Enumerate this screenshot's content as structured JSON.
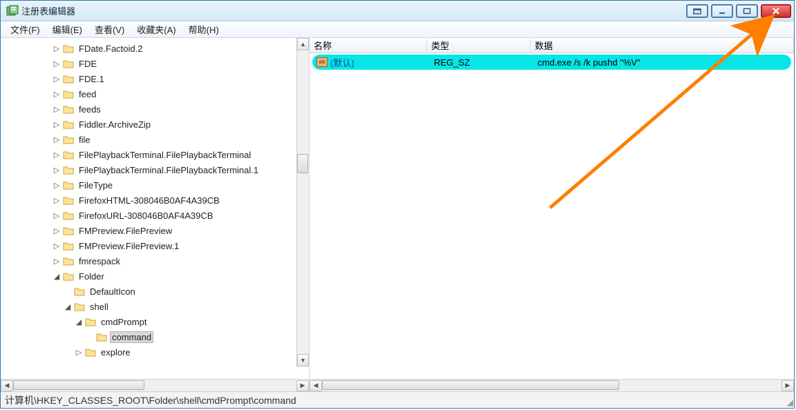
{
  "window": {
    "title": "注册表编辑器"
  },
  "menu": {
    "file": "文件(F)",
    "edit": "编辑(E)",
    "view": "查看(V)",
    "fav": "收藏夹(A)",
    "help": "帮助(H)"
  },
  "tree": {
    "nodes": [
      {
        "depth": 3,
        "expand": "▷",
        "label": "FDate.Factoid.2"
      },
      {
        "depth": 3,
        "expand": "▷",
        "label": "FDE"
      },
      {
        "depth": 3,
        "expand": "▷",
        "label": "FDE.1"
      },
      {
        "depth": 3,
        "expand": "▷",
        "label": "feed"
      },
      {
        "depth": 3,
        "expand": "▷",
        "label": "feeds"
      },
      {
        "depth": 3,
        "expand": "▷",
        "label": "Fiddler.ArchiveZip"
      },
      {
        "depth": 3,
        "expand": "▷",
        "label": "file"
      },
      {
        "depth": 3,
        "expand": "▷",
        "label": "FilePlaybackTerminal.FilePlaybackTerminal"
      },
      {
        "depth": 3,
        "expand": "▷",
        "label": "FilePlaybackTerminal.FilePlaybackTerminal.1"
      },
      {
        "depth": 3,
        "expand": "▷",
        "label": "FileType"
      },
      {
        "depth": 3,
        "expand": "▷",
        "label": "FirefoxHTML-308046B0AF4A39CB"
      },
      {
        "depth": 3,
        "expand": "▷",
        "label": "FirefoxURL-308046B0AF4A39CB"
      },
      {
        "depth": 3,
        "expand": "▷",
        "label": "FMPreview.FilePreview"
      },
      {
        "depth": 3,
        "expand": "▷",
        "label": "FMPreview.FilePreview.1"
      },
      {
        "depth": 3,
        "expand": "▷",
        "label": "fmrespack"
      },
      {
        "depth": 3,
        "expand": "◢",
        "label": "Folder"
      },
      {
        "depth": 4,
        "expand": " ",
        "label": "DefaultIcon"
      },
      {
        "depth": 4,
        "expand": "◢",
        "label": "shell"
      },
      {
        "depth": 5,
        "expand": "◢",
        "label": "cmdPrompt"
      },
      {
        "depth": 6,
        "expand": " ",
        "label": "command",
        "selected": true
      },
      {
        "depth": 5,
        "expand": "▷",
        "label": "explore"
      }
    ]
  },
  "list": {
    "headers": {
      "name": "名称",
      "type": "类型",
      "data": "数据"
    },
    "rows": [
      {
        "name": "(默认)",
        "type": "REG_SZ",
        "data": "cmd.exe /s /k pushd \"%V\"",
        "selected": true
      }
    ]
  },
  "status": {
    "path": "计算机\\HKEY_CLASSES_ROOT\\Folder\\shell\\cmdPrompt\\command"
  }
}
